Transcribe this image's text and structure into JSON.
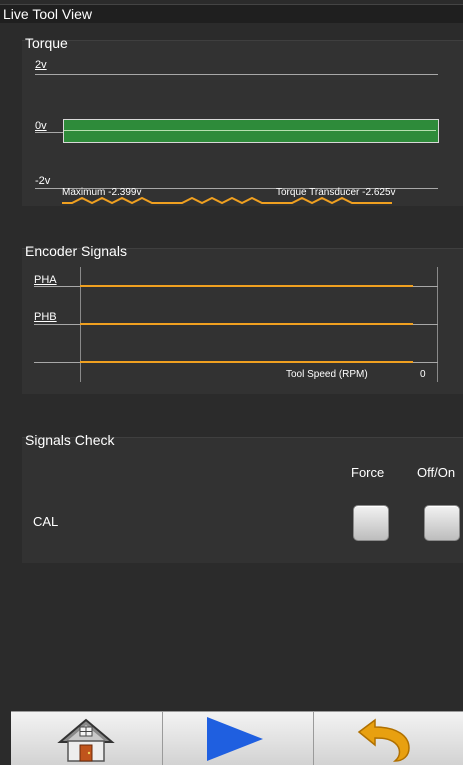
{
  "window": {
    "title": "Live Tool View"
  },
  "torque": {
    "title": "Torque",
    "axis": [
      "2v",
      "0v",
      "-2v"
    ],
    "maximum": "Maximum -2.399v",
    "transducer": "Torque Transducer -2.625v"
  },
  "encoder": {
    "title": "Encoder Signals",
    "channels": [
      "PHA",
      "PHB"
    ],
    "speed_label": "Tool Speed (RPM)",
    "speed_value": "0"
  },
  "signals_check": {
    "title": "Signals Check",
    "columns": [
      "Force",
      "Off/On"
    ],
    "rows": [
      {
        "label": "CAL",
        "force": false,
        "on": false
      }
    ]
  },
  "toolbar": {
    "items": [
      "home-icon",
      "play-icon",
      "undo-icon"
    ]
  },
  "colors": {
    "bar": "#2e8b3a",
    "signal": "#f0a020",
    "play": "#1f5fe0",
    "undo": "#e8a010"
  }
}
